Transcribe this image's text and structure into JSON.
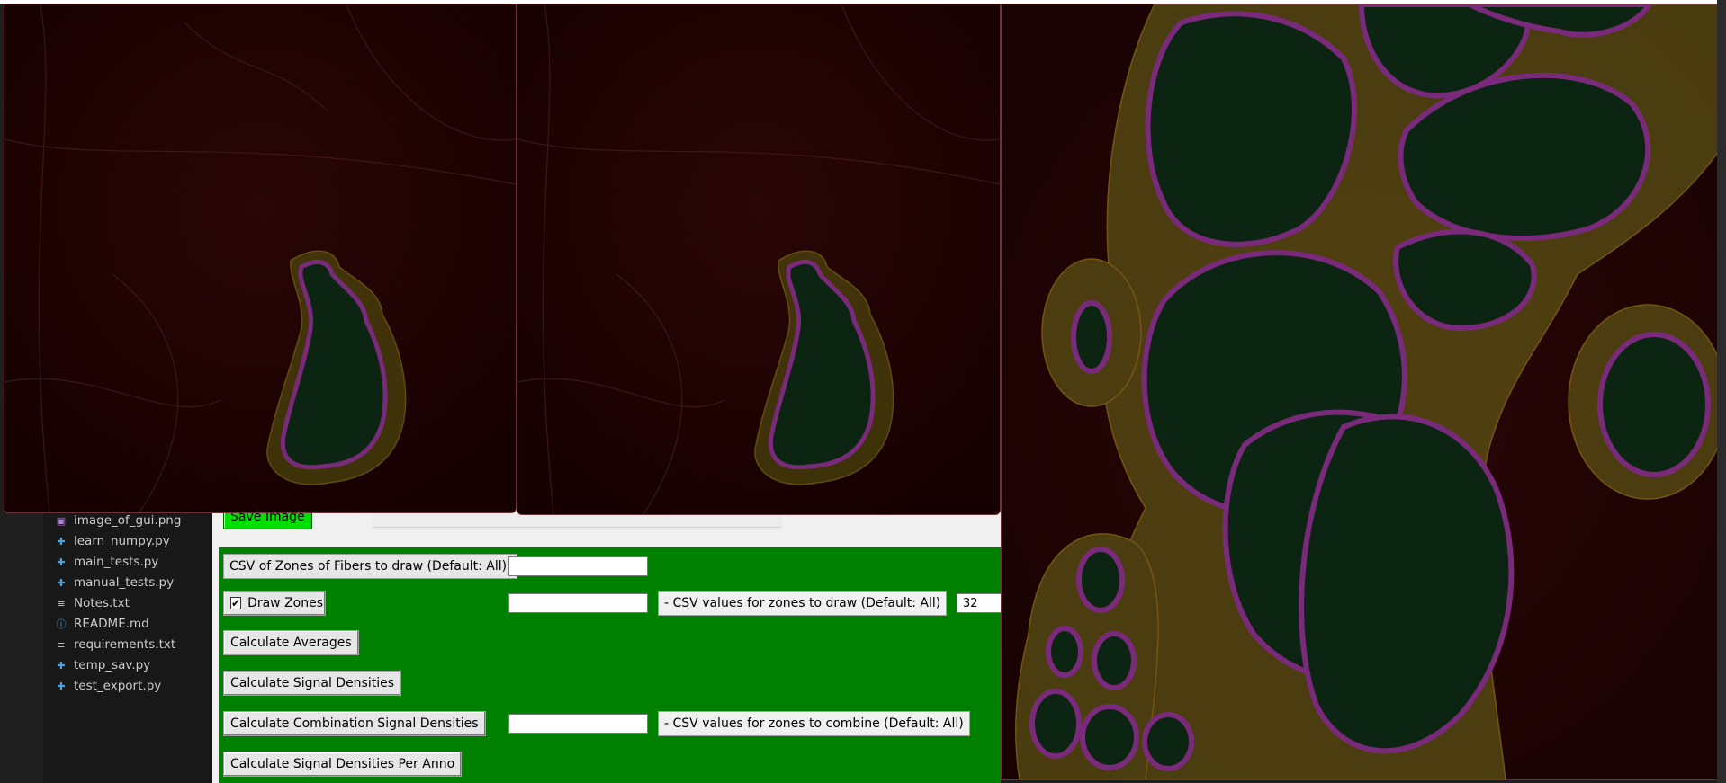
{
  "explorer": {
    "files": [
      {
        "name": "image_of_gui.png",
        "icon": "image-file-icon"
      },
      {
        "name": "learn_numpy.py",
        "icon": "python-file-icon"
      },
      {
        "name": "main_tests.py",
        "icon": "python-file-icon"
      },
      {
        "name": "manual_tests.py",
        "icon": "python-file-icon"
      },
      {
        "name": "Notes.txt",
        "icon": "text-file-icon"
      },
      {
        "name": "README.md",
        "icon": "info-file-icon"
      },
      {
        "name": "requirements.txt",
        "icon": "text-file-icon"
      },
      {
        "name": "temp_sav.py",
        "icon": "python-file-icon"
      },
      {
        "name": "test_export.py",
        "icon": "python-file-icon"
      }
    ]
  },
  "gui": {
    "save_image_label": "Save Image",
    "zones_label": "CSV of Zones of Fibers to draw (Default: All):",
    "zones_value": "",
    "draw_zones_label": "Draw Zones",
    "draw_zones_checked": true,
    "draw_zones_value": "",
    "draw_zones_csv_label": "- CSV values for zones to draw (Default: All)",
    "draw_zones_extra_value": "32",
    "calc_averages_label": "Calculate Averages",
    "calc_signal_densities_label": "Calculate Signal Densities",
    "calc_combination_label": "Calculate Combination Signal Densities",
    "combination_value": "",
    "combination_csv_label": "- CSV values for zones to combine (Default: All)",
    "calc_per_anno_label": "Calculate Signal Densities Per Anno"
  },
  "colors": {
    "panel_green": "#008000",
    "save_button_green": "#00e000",
    "image_background": "#1a0000",
    "fiber_fill": "#0a2a12",
    "inner_zone_ring": "#5a1f5a",
    "outer_zone_ring": "#7a7a1a"
  }
}
